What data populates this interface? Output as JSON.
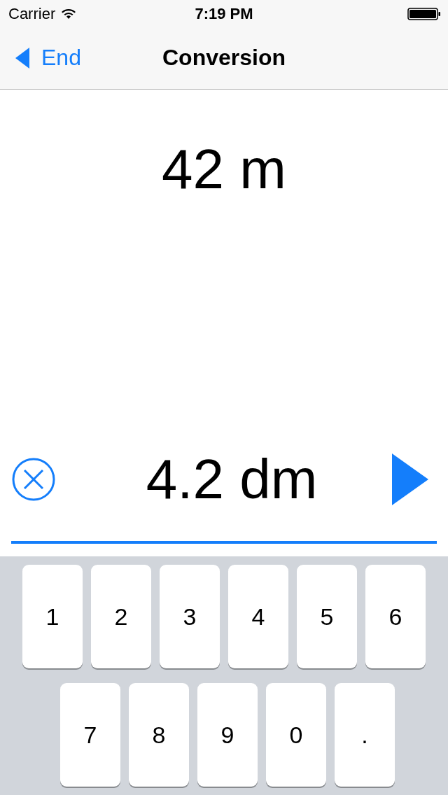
{
  "status_bar": {
    "carrier": "Carrier",
    "time": "7:19 PM"
  },
  "nav_bar": {
    "back_label": "End",
    "title": "Conversion"
  },
  "result": "42 m",
  "input": {
    "value": "4.2 dm"
  },
  "keyboard": {
    "rows": [
      [
        "1",
        "2",
        "3",
        "4",
        "5",
        "6"
      ],
      [
        "7",
        "8",
        "9",
        "0",
        "."
      ]
    ]
  }
}
